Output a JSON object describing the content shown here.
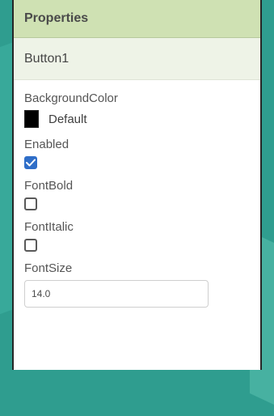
{
  "panel": {
    "title": "Properties",
    "component": "Button1"
  },
  "properties": {
    "background_color": {
      "label": "BackgroundColor",
      "value": "Default",
      "swatch_color": "#000000"
    },
    "enabled": {
      "label": "Enabled",
      "checked": true
    },
    "font_bold": {
      "label": "FontBold",
      "checked": false
    },
    "font_italic": {
      "label": "FontItalic",
      "checked": false
    },
    "font_size": {
      "label": "FontSize",
      "value": "14.0"
    }
  },
  "colors": {
    "accent_checkbox": "#2f6ec8",
    "header_bg": "#cfe1b3",
    "component_bg": "#eef3e7",
    "page_bg": "#2f9d8f"
  },
  "icons": {
    "checkmark": "checkmark-icon"
  }
}
